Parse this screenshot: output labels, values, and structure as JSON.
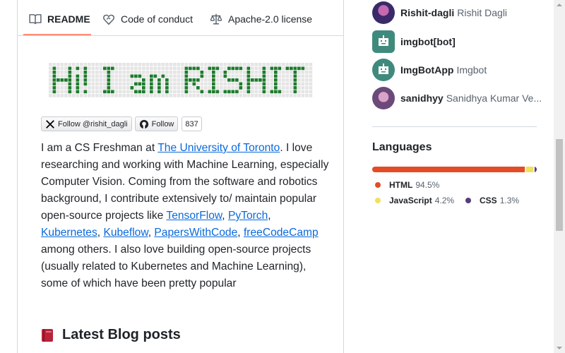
{
  "tabs": [
    {
      "label": "README",
      "icon": "book-icon",
      "active": true
    },
    {
      "label": "Code of conduct",
      "icon": "heart-shield-icon",
      "active": false
    },
    {
      "label": "Apache-2.0 license",
      "icon": "scale-icon",
      "active": false
    }
  ],
  "banner": {
    "text": "Hi! I am RISHIT",
    "colors": {
      "on": "#1e7b2c",
      "off": "#e5e5e5"
    }
  },
  "badges": {
    "twitter": "Follow @rishit_dagli",
    "github": "Follow",
    "github_count": "837"
  },
  "bio": {
    "p1": "I am a CS Freshman at ",
    "link_uoft": "The University of Toronto",
    "p2": ". I love researching and working with Machine Learning, especially Computer Vision. Coming from the software and robotics background, I contribute extensively to/ maintain popular open-source projects like ",
    "link_tf": "TensorFlow",
    "sep1": ", ",
    "link_pt": "PyTorch",
    "sep2": ", ",
    "link_k8s": "Kubernetes",
    "sep3": ", ",
    "link_kf": "Kubeflow",
    "sep4": ", ",
    "link_pwc": "PapersWithCode",
    "sep5": ", ",
    "link_fcc": "freeCodeCamp",
    "p3": " among others. I also love building open-source projects (usually related to Kubernetes and Machine Learning), some of which have been pretty popular"
  },
  "blog_heading": "Latest Blog posts",
  "contributors": [
    {
      "login": "Rishit-dagli",
      "name": "Rishit Dagli",
      "avatar": "user-avatar-icon"
    },
    {
      "login": "imgbot[bot]",
      "name": "",
      "avatar": "robot-avatar-icon"
    },
    {
      "login": "ImgBotApp",
      "name": "Imgbot",
      "avatar": "robot-avatar-icon"
    },
    {
      "login": "sanidhyy",
      "name": "Sanidhya Kumar Ve...",
      "avatar": "user-avatar-icon"
    }
  ],
  "languages": {
    "title": "Languages",
    "items": [
      {
        "name": "HTML",
        "percent": "94.5%",
        "value": 94.5,
        "color": "#e34c26"
      },
      {
        "name": "JavaScript",
        "percent": "4.2%",
        "value": 4.2,
        "color": "#f1e05a"
      },
      {
        "name": "CSS",
        "percent": "1.3%",
        "value": 1.3,
        "color": "#563d7c"
      }
    ]
  },
  "colors": {
    "link": "#0969da",
    "tab_underline": "#fd8c73",
    "robot": "#3f8a7c"
  }
}
